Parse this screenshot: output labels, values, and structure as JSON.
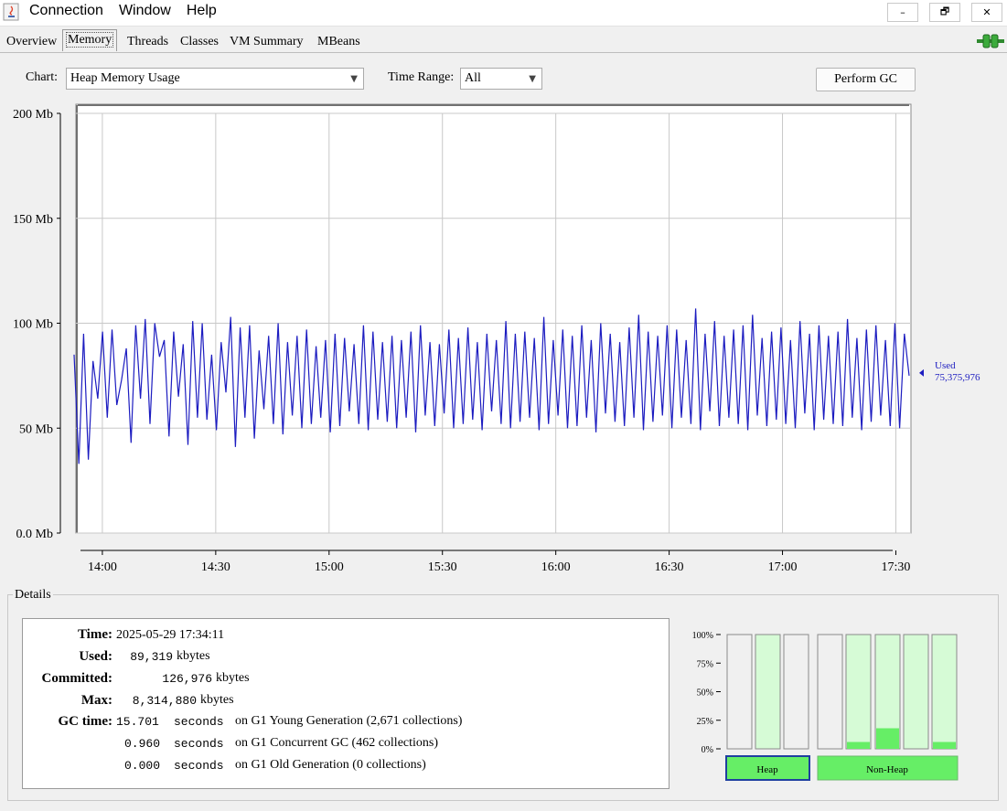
{
  "menu": [
    "Connection",
    "Window",
    "Help"
  ],
  "window_buttons": {
    "minimize": "–",
    "restore": "🗗",
    "close": "✕"
  },
  "tabs": [
    {
      "label": "Overview",
      "active": false
    },
    {
      "label": "Memory",
      "active": true
    },
    {
      "label": "Threads",
      "active": false
    },
    {
      "label": "Classes",
      "active": false
    },
    {
      "label": "VM Summary",
      "active": false
    },
    {
      "label": "MBeans",
      "active": false
    }
  ],
  "toolbar": {
    "chart_label": "Chart:",
    "chart_value": "Heap Memory Usage",
    "range_label": "Time Range:",
    "range_value": "All",
    "gc_button": "Perform GC"
  },
  "colors": {
    "line": "#1c1cc0",
    "grid": "#c8c8c8",
    "bar_fill": "#66ee66",
    "bar_bg": "#d6fbd6",
    "bar_empty": "#f0f0f0"
  },
  "chart_data": {
    "type": "line",
    "y_ticks": [
      "200 Mb",
      "150 Mb",
      "100 Mb",
      "50 Mb",
      "0.0 Mb"
    ],
    "x_ticks": [
      "14:00",
      "14:30",
      "15:00",
      "15:30",
      "16:00",
      "16:30",
      "17:00",
      "17:30"
    ],
    "ylim": [
      0,
      200
    ],
    "xlim": [
      "13:53",
      "17:34"
    ],
    "series": [
      {
        "name": "Used",
        "current_value": "75,375,976",
        "x_start": "13:53",
        "x_end": "17:34",
        "values": [
          85,
          33,
          95,
          35,
          82,
          64,
          96,
          55,
          97,
          61,
          73,
          88,
          43,
          99,
          64,
          102,
          52,
          100,
          84,
          92,
          46,
          96,
          65,
          90,
          42,
          101,
          55,
          100,
          54,
          85,
          49,
          91,
          67,
          103,
          41,
          98,
          55,
          99,
          45,
          87,
          59,
          94,
          52,
          100,
          47,
          91,
          56,
          94,
          50,
          97,
          52,
          89,
          55,
          92,
          48,
          95,
          51,
          93,
          58,
          90,
          52,
          99,
          49,
          96,
          54,
          91,
          53,
          94,
          50,
          92,
          55,
          96,
          48,
          99,
          56,
          91,
          51,
          90,
          57,
          97,
          50,
          93,
          52,
          98,
          54,
          91,
          49,
          95,
          58,
          92,
          52,
          101,
          50,
          95,
          53,
          96,
          55,
          93,
          49,
          103,
          52,
          92,
          56,
          97,
          50,
          94,
          51,
          99,
          55,
          92,
          48,
          100,
          57,
          95,
          53,
          91,
          51,
          98,
          55,
          104,
          49,
          96,
          53,
          94,
          56,
          99,
          50,
          97,
          55,
          92,
          52,
          107,
          49,
          95,
          58,
          101,
          51,
          94,
          55,
          97,
          52,
          99,
          49,
          104,
          56,
          93,
          51,
          96,
          54,
          98,
          52,
          92,
          50,
          101,
          57,
          95,
          49,
          99,
          54,
          94,
          52,
          96,
          51,
          102,
          55,
          93,
          49,
          97,
          53,
          99,
          56,
          92,
          51,
          100,
          50,
          95,
          75
        ]
      }
    ]
  },
  "details": {
    "title": "Details",
    "time_label": "Time:",
    "time_value": "2025-05-29 17:34:11",
    "used_label": "Used:",
    "used_value": "89,319",
    "used_unit": "kbytes",
    "committed_label": "Committed:",
    "committed_value": "126,976",
    "committed_unit": "kbytes",
    "max_label": "Max:",
    "max_value": "8,314,880",
    "max_unit": "kbytes",
    "gc_label": "GC time:",
    "gc": [
      {
        "seconds": "15.701",
        "unit": "seconds",
        "text": "on G1 Young Generation (2,671 collections)"
      },
      {
        "seconds": "0.960",
        "unit": "seconds",
        "text": "on G1 Concurrent GC (462 collections)"
      },
      {
        "seconds": "0.000",
        "unit": "seconds",
        "text": "on G1 Old Generation (0 collections)"
      }
    ]
  },
  "pools": {
    "ticks": [
      "100%",
      "75%",
      "50%",
      "25%",
      "0%"
    ],
    "heap_label": "Heap",
    "nonheap_label": "Non-Heap",
    "heap": [
      {
        "used": 0.0,
        "committed": 0.0
      },
      {
        "used": 0.0,
        "committed": 1.0
      },
      {
        "used": 0.0,
        "committed": 0.0
      }
    ],
    "nonheap": [
      {
        "used": 0.0,
        "committed": 0.0
      },
      {
        "used": 0.06,
        "committed": 1.0
      },
      {
        "used": 0.18,
        "committed": 1.0
      },
      {
        "used": 0.0,
        "committed": 1.0
      },
      {
        "used": 0.06,
        "committed": 1.0
      }
    ]
  }
}
